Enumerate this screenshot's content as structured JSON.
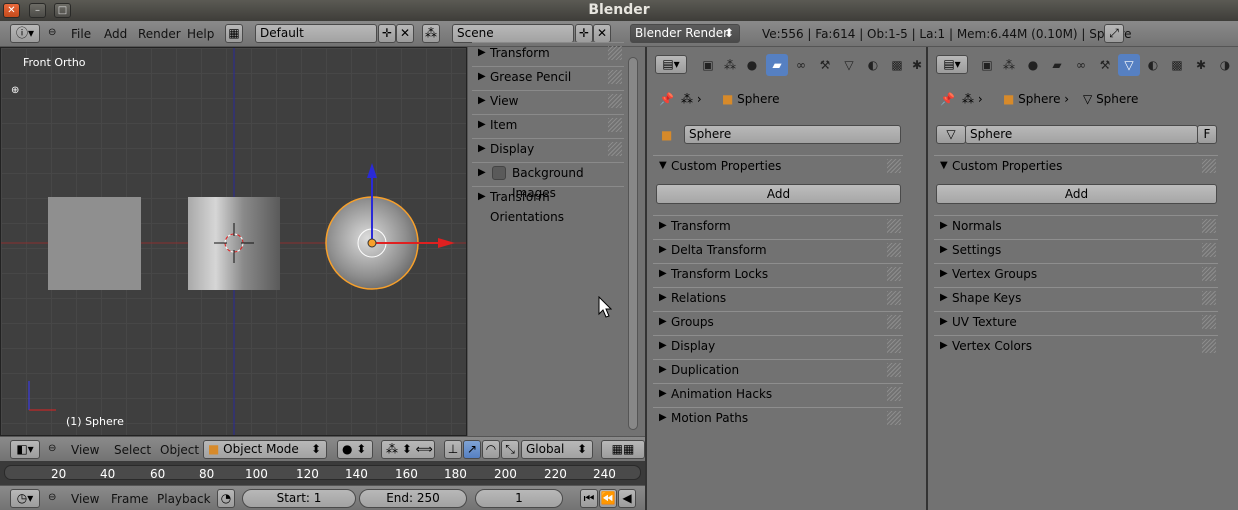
{
  "window": {
    "title": "Blender"
  },
  "info_header": {
    "menus": [
      "File",
      "Add",
      "Render",
      "Help"
    ],
    "screen_layout": "Default",
    "scene": "Scene",
    "render_engine": "Blender Render",
    "stats": "Ve:556 | Fa:614 | Ob:1-5 | La:1 | Mem:6.44M (0.10M) | Sphere"
  },
  "viewport": {
    "view_name": "Front Ortho",
    "object_label": "(1) Sphere",
    "header": {
      "menus": [
        "View",
        "Select",
        "Object"
      ],
      "mode": "Object Mode",
      "orientation": "Global"
    }
  },
  "npanel": {
    "items": [
      "Transform",
      "Grease Pencil",
      "View",
      "Item",
      "Display",
      "Background Images",
      "Transform Orientations"
    ]
  },
  "object_props": {
    "breadcrumb": "Sphere",
    "object_name": "Sphere",
    "custom_properties": "Custom Properties",
    "add_label": "Add",
    "panels": [
      "Transform",
      "Delta Transform",
      "Transform Locks",
      "Relations",
      "Groups",
      "Display",
      "Duplication",
      "Animation Hacks",
      "Motion Paths"
    ]
  },
  "mesh_props": {
    "breadcrumb_object": "Sphere",
    "breadcrumb_mesh": "Sphere",
    "mesh_name": "Sphere",
    "fake_user": "F",
    "custom_properties": "Custom Properties",
    "add_label": "Add",
    "panels": [
      "Normals",
      "Settings",
      "Vertex Groups",
      "Shape Keys",
      "UV Texture",
      "Vertex Colors"
    ]
  },
  "timeline": {
    "ticks": [
      "20",
      "40",
      "60",
      "80",
      "100",
      "120",
      "140",
      "160",
      "180",
      "200",
      "220",
      "240"
    ],
    "header": {
      "menus": [
        "View",
        "Frame",
        "Playback"
      ],
      "start": "Start: 1",
      "end": "End: 250",
      "current": "1"
    }
  }
}
